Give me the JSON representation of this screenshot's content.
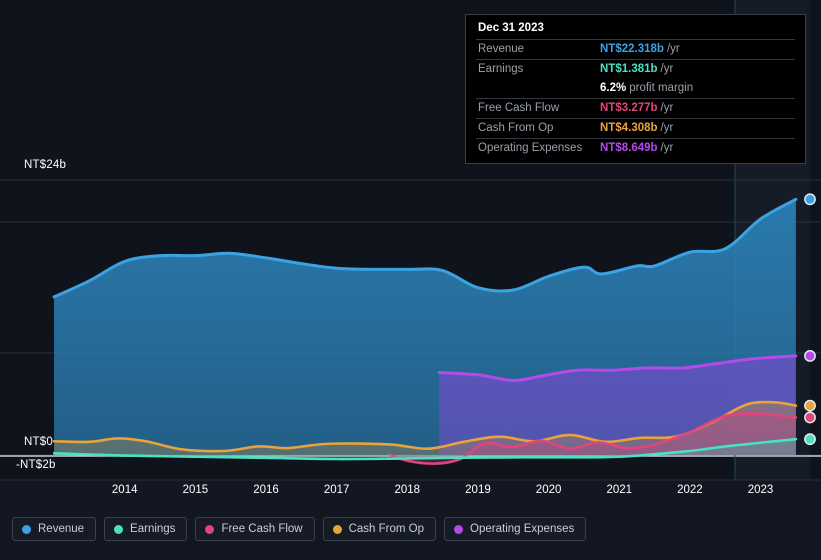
{
  "chart_data": {
    "type": "area",
    "title": "",
    "xlabel": "",
    "ylabel": "",
    "currency": "NT$",
    "grid": true,
    "legend_position": "bottom",
    "xlim": [
      2013.4,
      2024.2
    ],
    "ylim": [
      -2,
      24
    ],
    "y_ticks": [
      {
        "value": 24,
        "label": "NT$24b"
      },
      {
        "value": 0,
        "label": "NT$0"
      },
      {
        "value": -2,
        "label": "-NT$2b"
      }
    ],
    "x_ticks": [
      "2014",
      "2015",
      "2016",
      "2017",
      "2018",
      "2019",
      "2020",
      "2021",
      "2022",
      "2023"
    ],
    "series": [
      {
        "name": "Revenue",
        "color": "#3aa3e3",
        "fill": "#1d4664",
        "x": [
          2013.5,
          2014.0,
          2014.5,
          2015.0,
          2015.5,
          2016.0,
          2016.5,
          2017.0,
          2017.5,
          2018.0,
          2018.5,
          2019.0,
          2019.5,
          2020.0,
          2020.5,
          2021.0,
          2021.25,
          2021.75,
          2022.0,
          2022.5,
          2023.0,
          2023.5,
          2024.0
        ],
        "values": [
          13.8,
          15.2,
          16.9,
          17.4,
          17.4,
          17.6,
          17.2,
          16.7,
          16.3,
          16.2,
          16.2,
          16.1,
          14.6,
          14.4,
          15.6,
          16.4,
          15.8,
          16.5,
          16.5,
          17.7,
          18.0,
          20.6,
          22.318
        ]
      },
      {
        "name": "Earnings",
        "color": "#4de0c0",
        "fill": "#1d5a56",
        "x": [
          2013.5,
          2014.5,
          2015.5,
          2016.5,
          2017.5,
          2018.5,
          2019.5,
          2020.5,
          2021.5,
          2022.5,
          2023.0,
          2024.0
        ],
        "values": [
          0.15,
          -0.05,
          -0.15,
          -0.25,
          -0.35,
          -0.3,
          -0.22,
          -0.2,
          -0.15,
          0.35,
          0.75,
          1.381
        ]
      },
      {
        "name": "Free Cash Flow",
        "color": "#e0457b",
        "fill": "#6a2murky",
        "x": [
          2018.25,
          2018.5,
          2018.9,
          2019.25,
          2019.6,
          2020.0,
          2020.4,
          2020.8,
          2021.2,
          2021.6,
          2022.0,
          2022.5,
          2023.0,
          2023.5,
          2024.0
        ],
        "values": [
          0.05,
          -0.5,
          -0.75,
          -0.35,
          1.0,
          0.7,
          1.25,
          0.55,
          1.1,
          0.6,
          0.9,
          2.0,
          3.4,
          3.6,
          3.277
        ]
      },
      {
        "name": "Cash From Op",
        "color": "#e8a33d",
        "fill": "#4a4035",
        "x": [
          2013.5,
          2014.0,
          2014.4,
          2014.8,
          2015.3,
          2015.9,
          2016.4,
          2016.8,
          2017.3,
          2017.8,
          2018.3,
          2018.8,
          2019.3,
          2019.8,
          2020.3,
          2020.8,
          2021.3,
          2021.8,
          2022.3,
          2022.8,
          2023.3,
          2023.7,
          2024.0
        ],
        "values": [
          1.2,
          1.15,
          1.45,
          1.2,
          0.5,
          0.35,
          0.75,
          0.6,
          0.95,
          1.0,
          0.9,
          0.55,
          1.15,
          1.6,
          1.2,
          1.75,
          1.15,
          1.5,
          1.6,
          2.8,
          4.4,
          4.6,
          4.308
        ]
      },
      {
        "name": "Operating Expenses",
        "color": "#b44ae8",
        "fill": "#3f3370",
        "x": [
          2018.95,
          2019.5,
          2020.0,
          2020.4,
          2020.9,
          2021.4,
          2021.9,
          2022.4,
          2022.9,
          2023.4,
          2024.0
        ],
        "values": [
          7.2,
          7.0,
          6.5,
          6.9,
          7.4,
          7.4,
          7.6,
          7.6,
          8.0,
          8.4,
          8.649
        ]
      }
    ],
    "end_markers": [
      {
        "series": "Revenue",
        "value": 22.318
      },
      {
        "series": "Operating Expenses",
        "value": 8.649
      },
      {
        "series": "Cash From Op",
        "value": 4.308
      },
      {
        "series": "Free Cash Flow",
        "value": 3.277
      },
      {
        "series": "Earnings",
        "value": 1.381
      }
    ]
  },
  "tooltip": {
    "date": "Dec 31 2023",
    "rows": [
      {
        "key": "Revenue",
        "value": "NT$22.318b",
        "unit": "/yr",
        "color": "#3aa3e3"
      },
      {
        "key": "Earnings",
        "value": "NT$1.381b",
        "unit": "/yr",
        "color": "#4de0c0"
      },
      {
        "key": "",
        "value": "6.2%",
        "unit": "profit margin",
        "color": "#ffffff"
      },
      {
        "key": "Free Cash Flow",
        "value": "NT$3.277b",
        "unit": "/yr",
        "color": "#e0457b"
      },
      {
        "key": "Cash From Op",
        "value": "NT$4.308b",
        "unit": "/yr",
        "color": "#e8a33d"
      },
      {
        "key": "Operating Expenses",
        "value": "NT$8.649b",
        "unit": "/yr",
        "color": "#b44ae8"
      }
    ]
  },
  "legend": {
    "items": [
      {
        "label": "Revenue",
        "color": "#3aa3e3"
      },
      {
        "label": "Earnings",
        "color": "#4de0c0"
      },
      {
        "label": "Free Cash Flow",
        "color": "#e0457b"
      },
      {
        "label": "Cash From Op",
        "color": "#e8a33d"
      },
      {
        "label": "Operating Expenses",
        "color": "#b44ae8"
      }
    ]
  }
}
